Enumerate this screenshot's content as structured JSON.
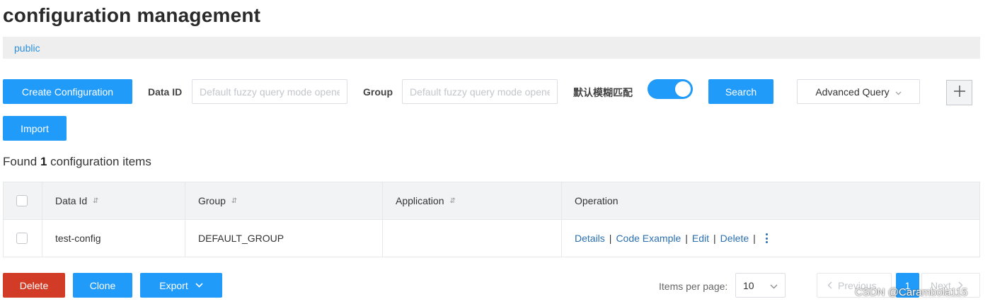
{
  "page": {
    "title": "configuration management"
  },
  "namespace": {
    "label": "public"
  },
  "toolbar": {
    "create_label": "Create Configuration",
    "data_id_label": "Data ID",
    "data_id_placeholder": "Default fuzzy query mode opened",
    "group_label": "Group",
    "group_placeholder": "Default fuzzy query mode opened",
    "fuzzy_label": "默认模糊匹配",
    "fuzzy_enabled": true,
    "search_label": "Search",
    "advanced_query_label": "Advanced Query",
    "plus_label": "+",
    "import_label": "Import"
  },
  "summary": {
    "prefix": "Found",
    "count": "1",
    "suffix": "configuration items"
  },
  "table": {
    "columns": [
      "Data Id",
      "Group",
      "Application",
      "Operation"
    ],
    "rows": [
      {
        "data_id": "test-config",
        "group": "DEFAULT_GROUP",
        "application": ""
      }
    ],
    "operations": [
      "Details",
      "Code Example",
      "Edit",
      "Delete"
    ],
    "separator": "|"
  },
  "footer": {
    "delete_label": "Delete",
    "clone_label": "Clone",
    "export_label": "Export",
    "items_per_page_label": "Items per page:",
    "items_per_page_value": "10",
    "previous_label": "Previous",
    "current_page": "1",
    "next_label": "Next"
  },
  "watermark": "CSDN @Carambola115",
  "colors": {
    "primary": "#209bfa",
    "danger": "#d23c26",
    "link": "#2a6fb0",
    "namespace_link": "#2b8fe0"
  },
  "icons": [
    "sort-icon",
    "chevron-down-icon",
    "plus-icon",
    "more-vertical-icon",
    "chevron-left-icon",
    "chevron-right-icon"
  ]
}
